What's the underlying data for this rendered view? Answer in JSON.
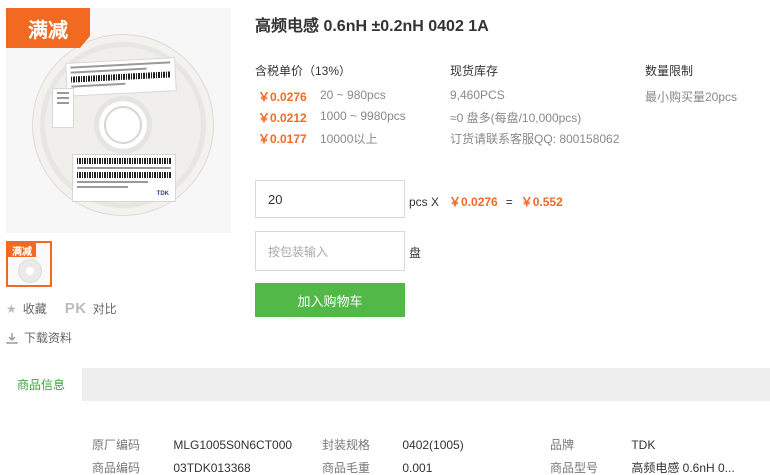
{
  "product": {
    "title": "高频电感 0.6nH ±0.2nH 0402 1A",
    "badge_text": "满减",
    "thumb_badge_text": "满减"
  },
  "pricing": {
    "header": "含税单价（13%）",
    "tiers": [
      {
        "price": "￥0.0276",
        "range": "20 ~ 980pcs"
      },
      {
        "price": "￥0.0212",
        "range": "1000 ~ 9980pcs"
      },
      {
        "price": "￥0.0177",
        "range": "10000以上"
      }
    ]
  },
  "stock": {
    "header": "现货库存",
    "lines": [
      "9,460PCS",
      "≈0 盘多(每盘/10,000pcs)",
      "订货请联系客服QQ: 800158062"
    ]
  },
  "limit": {
    "header": "数量限制",
    "line": "最小购买量20pcs"
  },
  "order": {
    "quantity_value": "20",
    "pcs_label": "pcs X",
    "unit_price": "￥0.0276",
    "equals": "=",
    "total": "￥0.552",
    "pack_placeholder": "按包装输入",
    "pack_unit": "盘",
    "add_cart_label": "加入购物车"
  },
  "actions": {
    "favorite_label": "收藏",
    "pk_label": "PK",
    "compare_label": "对比",
    "download_label": "下载资料"
  },
  "tabs": {
    "active": "商品信息"
  },
  "specs": {
    "row1": [
      {
        "key": "原厂编码",
        "value": "MLG1005S0N6CT000"
      },
      {
        "key": "封装规格",
        "value": "0402(1005)"
      },
      {
        "key": "品牌",
        "value": "TDK"
      }
    ],
    "row2": [
      {
        "key": "商品编码",
        "value": "03TDK013368"
      },
      {
        "key": "商品毛重",
        "value": "0.001"
      },
      {
        "key": "商品型号",
        "value": "高频电感 0.6nH 0..."
      }
    ]
  },
  "colors": {
    "accent_orange": "#f26a22",
    "cart_green": "#52b848",
    "tab_green": "#3aa33a"
  }
}
